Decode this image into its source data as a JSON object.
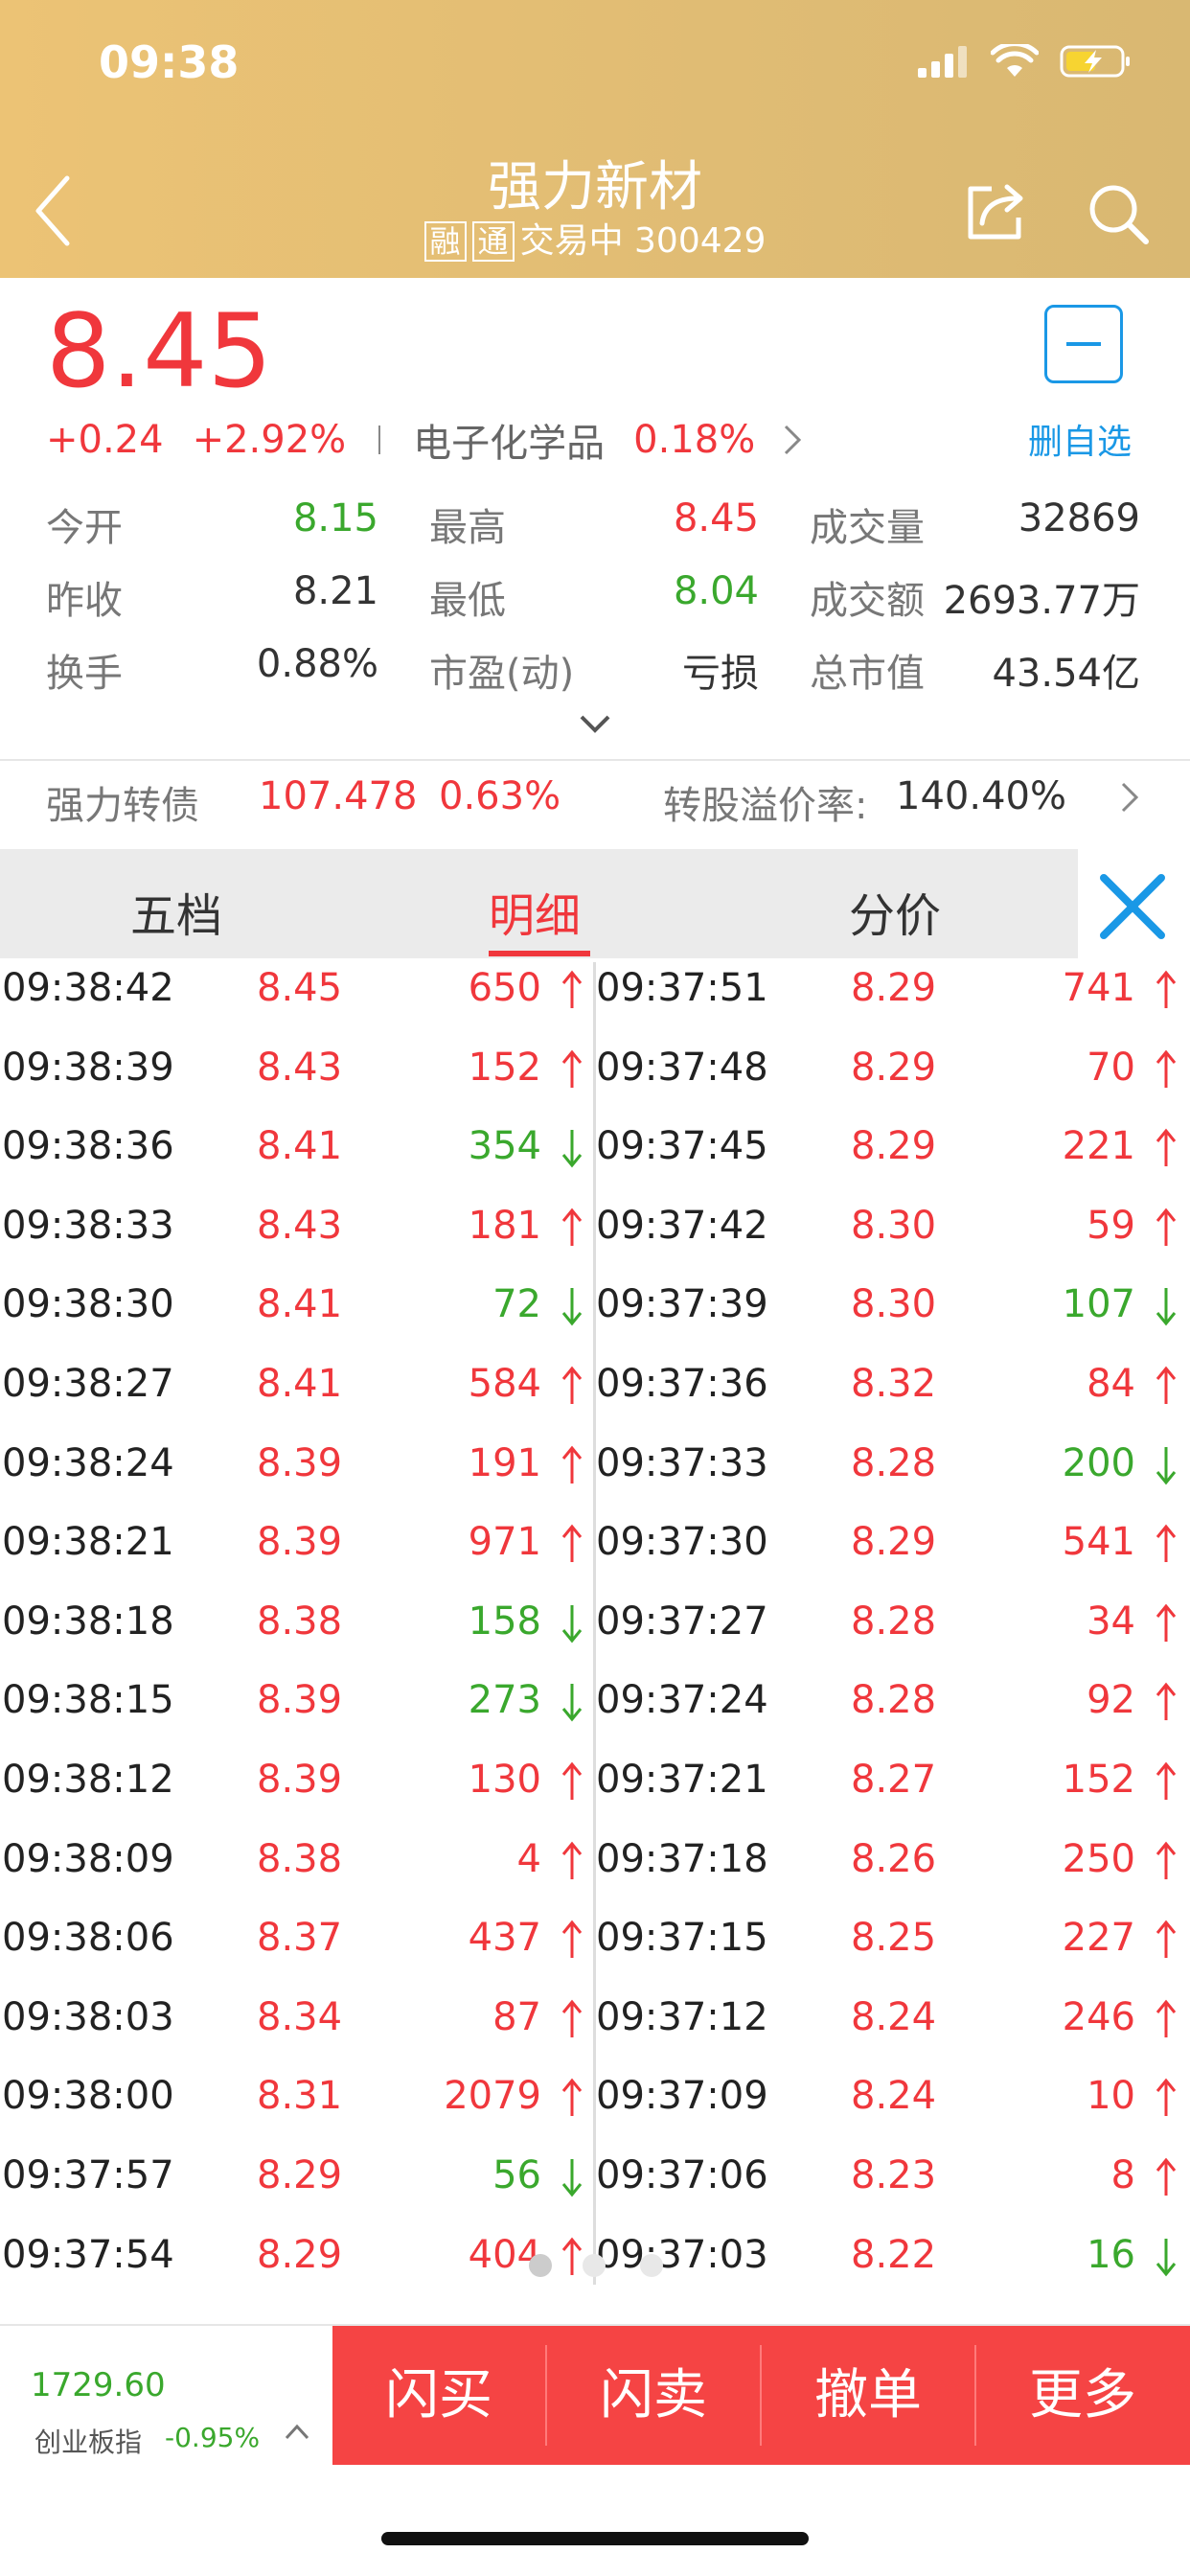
{
  "status_bar": {
    "time": "09:38"
  },
  "header": {
    "title": "强力新材",
    "tag_margin": "融",
    "tag_connect": "通",
    "trading_status": "交易中",
    "code": "300429"
  },
  "quote": {
    "price": "8.45",
    "change": "+0.24",
    "change_pct": "+2.92%",
    "sector": "电子化学品",
    "sector_pct": "0.18%",
    "fav_label": "删自选"
  },
  "stats": [
    [
      {
        "label": "今开",
        "value": "8.15",
        "color": "green"
      },
      {
        "label": "最高",
        "value": "8.45",
        "color": "red"
      },
      {
        "label": "成交量",
        "value": "32869",
        "color": "dark"
      }
    ],
    [
      {
        "label": "昨收",
        "value": "8.21",
        "color": "dark"
      },
      {
        "label": "最低",
        "value": "8.04",
        "color": "green"
      },
      {
        "label": "成交额",
        "value": "2693.77万",
        "color": "dark"
      }
    ],
    [
      {
        "label": "换手",
        "value": "0.88%",
        "color": "dark"
      },
      {
        "label": "市盈(动)",
        "value": "亏损",
        "color": "dark"
      },
      {
        "label": "总市值",
        "value": "43.54亿",
        "color": "dark"
      }
    ]
  ],
  "bond": {
    "name": "强力转债",
    "price": "107.478",
    "pct": "0.63%",
    "premium_label": "转股溢价率:",
    "premium_value": "140.40%"
  },
  "tabs": [
    "五档",
    "明细",
    "分价"
  ],
  "active_tab": 1,
  "colors": {
    "up": "#f0373c",
    "down": "#3aa82d",
    "accent": "#1a98e6",
    "header": "#e2bd74"
  },
  "ticks_left": [
    {
      "time": "09:38:42",
      "price": "8.45",
      "vol": "650",
      "dir": "up"
    },
    {
      "time": "09:38:39",
      "price": "8.43",
      "vol": "152",
      "dir": "up"
    },
    {
      "time": "09:38:36",
      "price": "8.41",
      "vol": "354",
      "dir": "down"
    },
    {
      "time": "09:38:33",
      "price": "8.43",
      "vol": "181",
      "dir": "up"
    },
    {
      "time": "09:38:30",
      "price": "8.41",
      "vol": "72",
      "dir": "down"
    },
    {
      "time": "09:38:27",
      "price": "8.41",
      "vol": "584",
      "dir": "up"
    },
    {
      "time": "09:38:24",
      "price": "8.39",
      "vol": "191",
      "dir": "up"
    },
    {
      "time": "09:38:21",
      "price": "8.39",
      "vol": "971",
      "dir": "up"
    },
    {
      "time": "09:38:18",
      "price": "8.38",
      "vol": "158",
      "dir": "down"
    },
    {
      "time": "09:38:15",
      "price": "8.39",
      "vol": "273",
      "dir": "down"
    },
    {
      "time": "09:38:12",
      "price": "8.39",
      "vol": "130",
      "dir": "up"
    },
    {
      "time": "09:38:09",
      "price": "8.38",
      "vol": "4",
      "dir": "up"
    },
    {
      "time": "09:38:06",
      "price": "8.37",
      "vol": "437",
      "dir": "up"
    },
    {
      "time": "09:38:03",
      "price": "8.34",
      "vol": "87",
      "dir": "up"
    },
    {
      "time": "09:38:00",
      "price": "8.31",
      "vol": "2079",
      "dir": "up"
    },
    {
      "time": "09:37:57",
      "price": "8.29",
      "vol": "56",
      "dir": "down"
    },
    {
      "time": "09:37:54",
      "price": "8.29",
      "vol": "404",
      "dir": "up"
    }
  ],
  "ticks_right": [
    {
      "time": "09:37:51",
      "price": "8.29",
      "vol": "741",
      "dir": "up"
    },
    {
      "time": "09:37:48",
      "price": "8.29",
      "vol": "70",
      "dir": "up"
    },
    {
      "time": "09:37:45",
      "price": "8.29",
      "vol": "221",
      "dir": "up"
    },
    {
      "time": "09:37:42",
      "price": "8.30",
      "vol": "59",
      "dir": "up"
    },
    {
      "time": "09:37:39",
      "price": "8.30",
      "vol": "107",
      "dir": "down"
    },
    {
      "time": "09:37:36",
      "price": "8.32",
      "vol": "84",
      "dir": "up"
    },
    {
      "time": "09:37:33",
      "price": "8.28",
      "vol": "200",
      "dir": "down"
    },
    {
      "time": "09:37:30",
      "price": "8.29",
      "vol": "541",
      "dir": "up"
    },
    {
      "time": "09:37:27",
      "price": "8.28",
      "vol": "34",
      "dir": "up"
    },
    {
      "time": "09:37:24",
      "price": "8.28",
      "vol": "92",
      "dir": "up"
    },
    {
      "time": "09:37:21",
      "price": "8.27",
      "vol": "152",
      "dir": "up"
    },
    {
      "time": "09:37:18",
      "price": "8.26",
      "vol": "250",
      "dir": "up"
    },
    {
      "time": "09:37:15",
      "price": "8.25",
      "vol": "227",
      "dir": "up"
    },
    {
      "time": "09:37:12",
      "price": "8.24",
      "vol": "246",
      "dir": "up"
    },
    {
      "time": "09:37:09",
      "price": "8.24",
      "vol": "10",
      "dir": "up"
    },
    {
      "time": "09:37:06",
      "price": "8.23",
      "vol": "8",
      "dir": "up"
    },
    {
      "time": "09:37:03",
      "price": "8.22",
      "vol": "16",
      "dir": "down"
    }
  ],
  "bottom_bar": {
    "index_value": "1729.60",
    "index_name": "创业板指",
    "index_change": "-0.95%",
    "actions": [
      "闪买",
      "闪卖",
      "撤单",
      "更多"
    ]
  }
}
